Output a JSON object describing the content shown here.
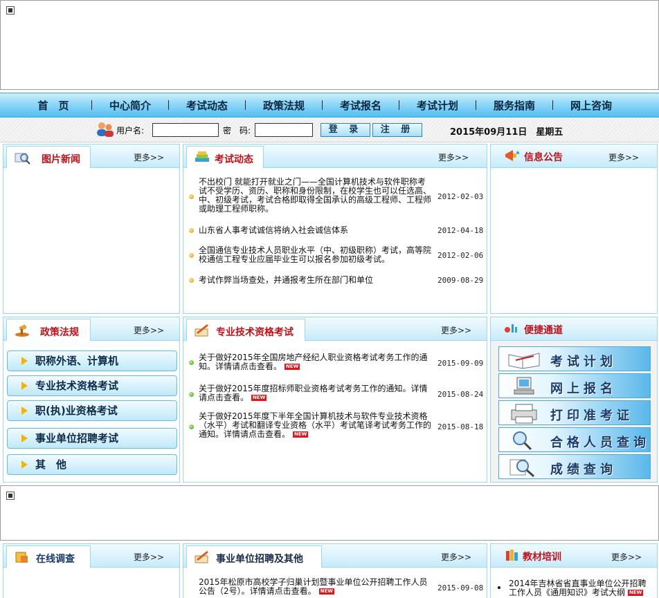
{
  "nav": [
    "首　页",
    "中心简介",
    "考试动态",
    "政策法规",
    "考试报名",
    "考试计划",
    "服务指南",
    "网上咨询"
  ],
  "login": {
    "user_label": "用户名:",
    "pass_label": "密　码:",
    "login_btn": "登 录",
    "register_btn": "注 册",
    "date": "2015年09月11日　星期五"
  },
  "more": "更多>>",
  "panels": {
    "pic_news": "图片新闻",
    "exam_news": "考试动态",
    "notice": "信息公告",
    "policy": "政策法规",
    "qualification": "专业技术资格考试",
    "quick": "便捷通道",
    "survey": "在线调查",
    "recruit": "事业单位招聘及其他",
    "training": "教材培训"
  },
  "exam_news": [
    {
      "title": "不出校门 就能打开就业之门——全国计算机技术与软件职称考试不受学历、资历、职称和身份限制，在校学生也可以任选高、中、初级考试，考试合格即取得全国承认的高级工程师、工程师或助理工程师职称。",
      "date": "2012-02-03"
    },
    {
      "title": "山东省人事考试诚信将纳入社会诚信体系",
      "date": "2012-04-18"
    },
    {
      "title": "全国通信专业技术人员职业水平（中、初级职称）考试，高等院校通信工程专业应届毕业生可以报名参加初级考试。",
      "date": "2012-02-06"
    },
    {
      "title": "考试作弊当场查处，并通报考生所在部门和单位",
      "date": "2009-08-29"
    }
  ],
  "qualification_news": [
    {
      "title": "关于做好2015年全国房地产经纪人职业资格考试考务工作的通知。详情请点击查看。",
      "date": "2015-09-09",
      "new": "NEW"
    },
    {
      "title": "关于做好2015年度招标师职业资格考试考务工作的通知。详情请点击查看。",
      "date": "2015-08-24",
      "new": "NEW"
    },
    {
      "title": "关于做好2015年度下半年全国计算机技术与软件专业技术资格（水平）考试和翻译专业资格（水平）考试笔译考试考务工作的通知。详情请点击查看。",
      "date": "2015-08-18",
      "new": "NEW"
    }
  ],
  "policy_categories": [
    "职称外语、计算机",
    "专业技术资格考试",
    "职(执)业资格考试",
    "事业单位招聘考试",
    "其　他"
  ],
  "quick_links": [
    "考试计划",
    "网上报名",
    "打印准考证",
    "合格人员查询",
    "成绩查询"
  ],
  "recruit_news": [
    {
      "title": "2015年松原市高校学子归巢计划暨事业单位公开招聘工作人员公告（2号）。详情请点击查看。",
      "date": "2015-09-08",
      "new": "NEW"
    }
  ],
  "training_news": [
    {
      "title": "2014年吉林省省直事业单位公开招聘工作人员《通用知识》考试大纲",
      "new": "NEW"
    }
  ],
  "colors": {
    "accent": "#53bff0",
    "title_red": "#c0101a",
    "border": "#9bd7f0"
  }
}
